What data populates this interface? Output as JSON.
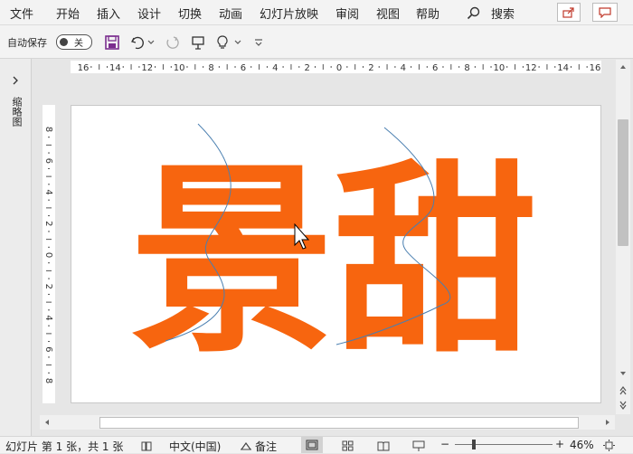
{
  "menu": {
    "items": [
      "文件",
      "开始",
      "插入",
      "设计",
      "切换",
      "动画",
      "幻灯片放映",
      "审阅",
      "视图",
      "帮助"
    ],
    "search_label": "搜索"
  },
  "qat": {
    "autosave_label": "自动保存",
    "autosave_state": "关"
  },
  "left_pane": {
    "label": "缩略图"
  },
  "rulers": {
    "horizontal_ticks": [
      "16",
      "14",
      "12",
      "10",
      "8",
      "6",
      "4",
      "2",
      "0",
      "2",
      "4",
      "6",
      "8",
      "10",
      "12",
      "14",
      "16"
    ],
    "vertical_ticks": [
      "8",
      "6",
      "4",
      "2",
      "0",
      "2",
      "4",
      "6",
      "8"
    ]
  },
  "slide": {
    "text": "景甜",
    "text_color": "#f7650f",
    "line_color": "#4a7fb0"
  },
  "status": {
    "slide_info": "幻灯片 第 1 张，共 1 张",
    "language": "中文(中国)",
    "notes": "备注",
    "zoom": "46%"
  }
}
